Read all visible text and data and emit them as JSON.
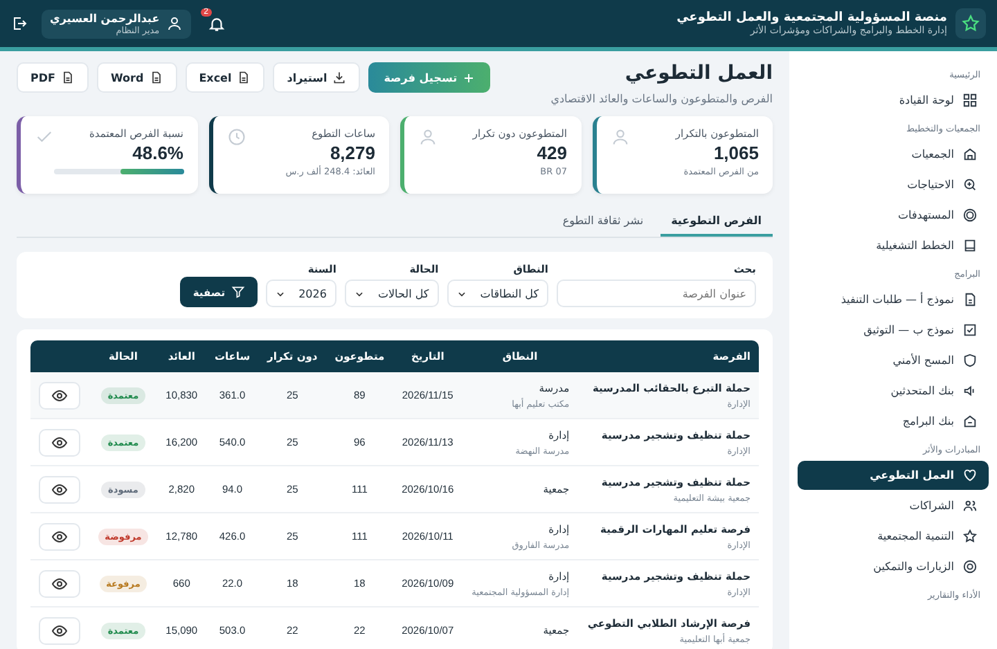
{
  "header": {
    "title": "منصة المسؤولية المجتمعية والعمل التطوعي",
    "subtitle": "إدارة الخطط والبرامج والشراكات ومؤشرات الأثر",
    "notifications": "2",
    "user": {
      "name": "عبدالرحمن العسيري",
      "role": "مدير النظام"
    }
  },
  "sidebar": [
    {
      "label": "الرئيسية",
      "items": [
        {
          "label": "لوحة القيادة",
          "selected": false
        }
      ]
    },
    {
      "label": "الجمعيات والتخطيط",
      "items": [
        {
          "label": "الجمعيات",
          "selected": false
        },
        {
          "label": "الاحتياجات",
          "selected": false
        },
        {
          "label": "المستهدفات",
          "selected": false
        },
        {
          "label": "الخطط التشغيلية",
          "selected": false
        }
      ]
    },
    {
      "label": "البرامج",
      "items": [
        {
          "label": "نموذج أ — طلبات التنفيذ",
          "selected": false
        },
        {
          "label": "نموذج ب — التوثيق",
          "selected": false
        },
        {
          "label": "المسح الأمني",
          "selected": false
        },
        {
          "label": "بنك المتحدثين",
          "selected": false
        },
        {
          "label": "بنك البرامج",
          "selected": false
        }
      ]
    },
    {
      "label": "المبادرات والأثر",
      "items": [
        {
          "label": "العمل التطوعي",
          "selected": true
        },
        {
          "label": "الشراكات",
          "selected": false
        },
        {
          "label": "التنمية المجتمعية",
          "selected": false
        },
        {
          "label": "الزيارات والتمكين",
          "selected": false
        }
      ]
    },
    {
      "label": "الأداء والتقارير"
    }
  ],
  "page": {
    "title": "العمل التطوعي",
    "subtitle": "الفرص والمتطوعون والساعات والعائد الاقتصادي"
  },
  "actions": [
    {
      "label": "تسجيل فرصة",
      "kind": "primary"
    },
    {
      "label": "استيراد",
      "kind": "import"
    },
    {
      "label": "Excel",
      "kind": "file"
    },
    {
      "label": "Word",
      "kind": "file"
    },
    {
      "label": "PDF",
      "kind": "file"
    }
  ],
  "kpis": [
    {
      "label": "المتطوعون بالتكرار",
      "value": "1,065",
      "note": "من الفرص المعتمدة",
      "color": "#2a8190",
      "kind": "user"
    },
    {
      "label": "المتطوعون دون تكرار",
      "value": "429",
      "note": "BR 07",
      "color": "#4caf6e",
      "kind": "user"
    },
    {
      "label": "ساعات التطوع",
      "value": "8,279",
      "note": "العائد: 248.4 ألف ر.س",
      "color": "#0f3a4a",
      "kind": "clock"
    },
    {
      "label": "نسبة الفرص المعتمدة",
      "value": "48.6%",
      "level": 0.486,
      "color": "#7b5ea7",
      "kind": "check"
    }
  ],
  "tabs": [
    {
      "label": "الفرص التطوعية",
      "selected": true
    },
    {
      "label": "نشر ثقافة التطوع",
      "selected": false
    }
  ],
  "filters": {
    "search": {
      "label": "بحث",
      "placeholder": "عنوان الفرصة"
    },
    "scope": {
      "label": "النطاق",
      "value": "كل النطاقات"
    },
    "status": {
      "label": "الحالة",
      "value": "كل الحالات"
    },
    "year": {
      "label": "السنة",
      "value": "2026"
    },
    "button": "تصفية"
  },
  "table": {
    "columns": [
      "الفرصة",
      "النطاق",
      "التاريخ",
      "متطوعون",
      "دون تكرار",
      "ساعات",
      "العائد",
      "الحالة"
    ],
    "rows": [
      {
        "title": "حملة التبرع بالحقائب المدرسية",
        "owner": "الإدارة",
        "scope": "مدرسة",
        "scope_detail": "مكتب تعليم أبها",
        "date": "2026/11/15",
        "volunteers": "89",
        "unique": "25",
        "hours": "361.0",
        "return": "10,830",
        "status": "معتمدة",
        "color": "#1f8a4c"
      },
      {
        "title": "حملة تنظيف وتشجير مدرسية",
        "owner": "الإدارة",
        "scope": "إدارة",
        "scope_detail": "مدرسة النهضة",
        "date": "2026/11/13",
        "volunteers": "96",
        "unique": "25",
        "hours": "540.0",
        "return": "16,200",
        "status": "معتمدة",
        "color": "#1f8a4c"
      },
      {
        "title": "حملة تنظيف وتشجير مدرسية",
        "owner": "جمعية بيشة التعليمية",
        "scope": "جمعية",
        "date": "2026/10/16",
        "volunteers": "111",
        "unique": "25",
        "hours": "94.0",
        "return": "2,820",
        "status": "مسودة",
        "color": "#5f6b7a"
      },
      {
        "title": "فرصة تعليم المهارات الرقمية",
        "owner": "الإدارة",
        "scope": "إدارة",
        "scope_detail": "مدرسة الفاروق",
        "date": "2026/10/11",
        "volunteers": "111",
        "unique": "25",
        "hours": "426.0",
        "return": "12,780",
        "status": "مرفوضة",
        "color": "#c0392b"
      },
      {
        "title": "حملة تنظيف وتشجير مدرسية",
        "owner": "الإدارة",
        "scope": "إدارة",
        "scope_detail": "إدارة المسؤولية المجتمعية",
        "date": "2026/10/09",
        "volunteers": "18",
        "unique": "18",
        "hours": "22.0",
        "return": "660",
        "status": "مرفوعة",
        "color": "#b7791f"
      },
      {
        "title": "فرصة الإرشاد الطلابي التطوعي",
        "owner": "جمعية أبها التعليمية",
        "scope": "جمعية",
        "date": "2026/10/07",
        "volunteers": "22",
        "unique": "22",
        "hours": "503.0",
        "return": "15,090",
        "status": "معتمدة",
        "color": "#1f8a4c"
      }
    ]
  }
}
